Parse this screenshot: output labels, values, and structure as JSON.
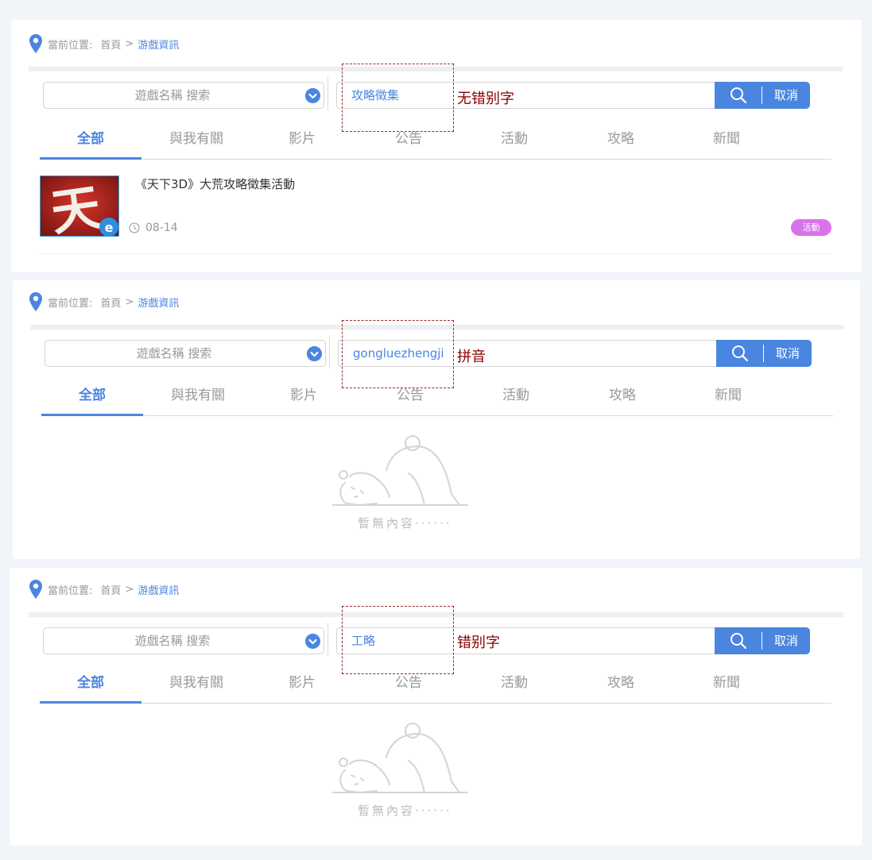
{
  "breadcrumb": {
    "label": "當前位置:",
    "home": "首頁",
    "separator": ">",
    "current": "游戲資訊"
  },
  "search": {
    "select_placeholder": "遊戲名稱 搜索",
    "cancel_label": "取消"
  },
  "tabs": [
    "全部",
    "與我有關",
    "影片",
    "公告",
    "活動",
    "攻略",
    "新聞"
  ],
  "panels": [
    {
      "query": "攻略徵集",
      "annotation": "无错别字"
    },
    {
      "query": "gongluezhengji",
      "annotation": "拼音"
    },
    {
      "query": "工略",
      "annotation": "错别字"
    }
  ],
  "result": {
    "title": "《天下3D》大荒攻略徵集活動",
    "date": "08-14",
    "badge": "活動",
    "thumb_glyph": "天"
  },
  "empty_text": "暫無內容······",
  "colors": {
    "accent": "#4a86e0",
    "badge": "#d873ec",
    "annotation": "#8b0000"
  }
}
